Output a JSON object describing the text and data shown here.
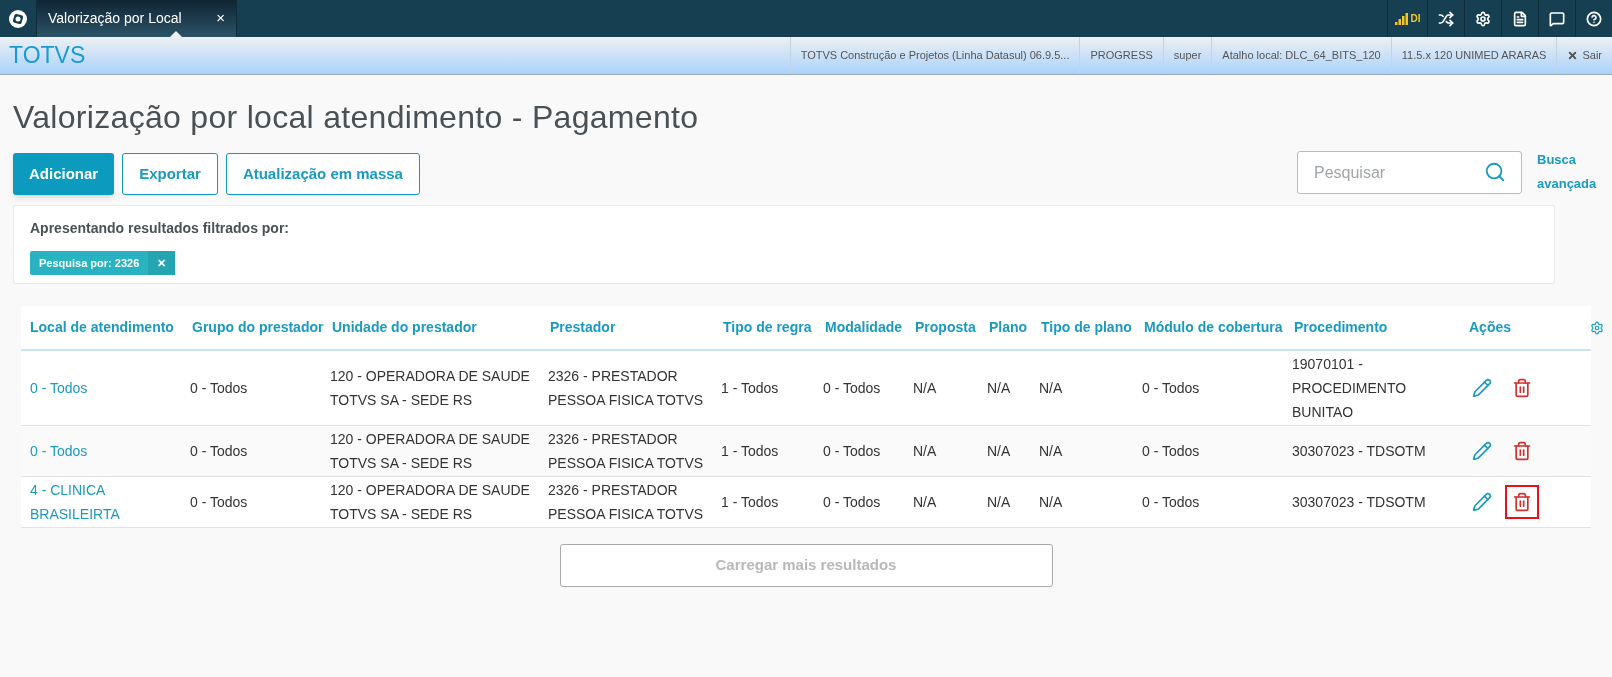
{
  "top_bar": {
    "tab": {
      "label": "Valorização por Local",
      "close": "×",
      "selected": true
    },
    "signal_label": "DI"
  },
  "header": {
    "brand": "TOTVS",
    "info": [
      "TOTVS Construção e Projetos (Linha Datasul) 06.9.5...",
      "PROGRESS",
      "super",
      "Atalho local: DLC_64_BITS_120",
      "11.5.x 120 UNIMED ARARAS"
    ],
    "logout": "Sair"
  },
  "page": {
    "title": "Valorização por local atendimento - Pagamento",
    "actions": [
      {
        "label": "Adicionar",
        "primary": true
      },
      {
        "label": "Exportar",
        "primary": false
      },
      {
        "label": "Atualização em massa",
        "primary": false
      }
    ],
    "search": {
      "placeholder": "Pesquisar"
    },
    "advanced_search": "Busca avançada",
    "filter": {
      "caption": "Apresentando resultados filtrados por:",
      "tags": [
        {
          "label": "Pesquisa por: 2326",
          "close": "✕"
        }
      ]
    },
    "table": {
      "columns": [
        "Local de atendimento",
        "Grupo do prestador",
        "Unidade do prestador",
        "Prestador",
        "Tipo de regra",
        "Modalidade",
        "Proposta",
        "Plano",
        "Tipo de plano",
        "Módulo de cobertura",
        "Procedimento",
        "Ações"
      ],
      "rows": [
        {
          "cells": [
            "0 - Todos",
            "0 - Todos",
            "120 - OPERADORA DE SAUDE TOTVS SA - SEDE RS",
            "2326 - PRESTADOR PESSOA FISICA TOTVS",
            "1 - Todos",
            "0 - Todos",
            "N/A",
            "N/A",
            "N/A",
            "0 - Todos",
            "19070101 - PROCEDIMENTO BUNITAO"
          ],
          "delete_highlighted": false
        },
        {
          "cells": [
            "0 - Todos",
            "0 - Todos",
            "120 - OPERADORA DE SAUDE TOTVS SA - SEDE RS",
            "2326 - PRESTADOR PESSOA FISICA TOTVS",
            "1 - Todos",
            "0 - Todos",
            "N/A",
            "N/A",
            "N/A",
            "0 - Todos",
            "30307023 - TDSOTM"
          ],
          "delete_highlighted": false
        },
        {
          "cells": [
            "4 - CLINICA BRASILEIRTA",
            "0 - Todos",
            "120 - OPERADORA DE SAUDE TOTVS SA - SEDE RS",
            "2326 - PRESTADOR PESSOA FISICA TOTVS",
            "1 - Todos",
            "0 - Todos",
            "N/A",
            "N/A",
            "N/A",
            "0 - Todos",
            "30307023 - TDSOTM"
          ],
          "delete_highlighted": true
        }
      ]
    },
    "load_more": {
      "label": "Carregar mais resultados",
      "disabled": true
    }
  }
}
